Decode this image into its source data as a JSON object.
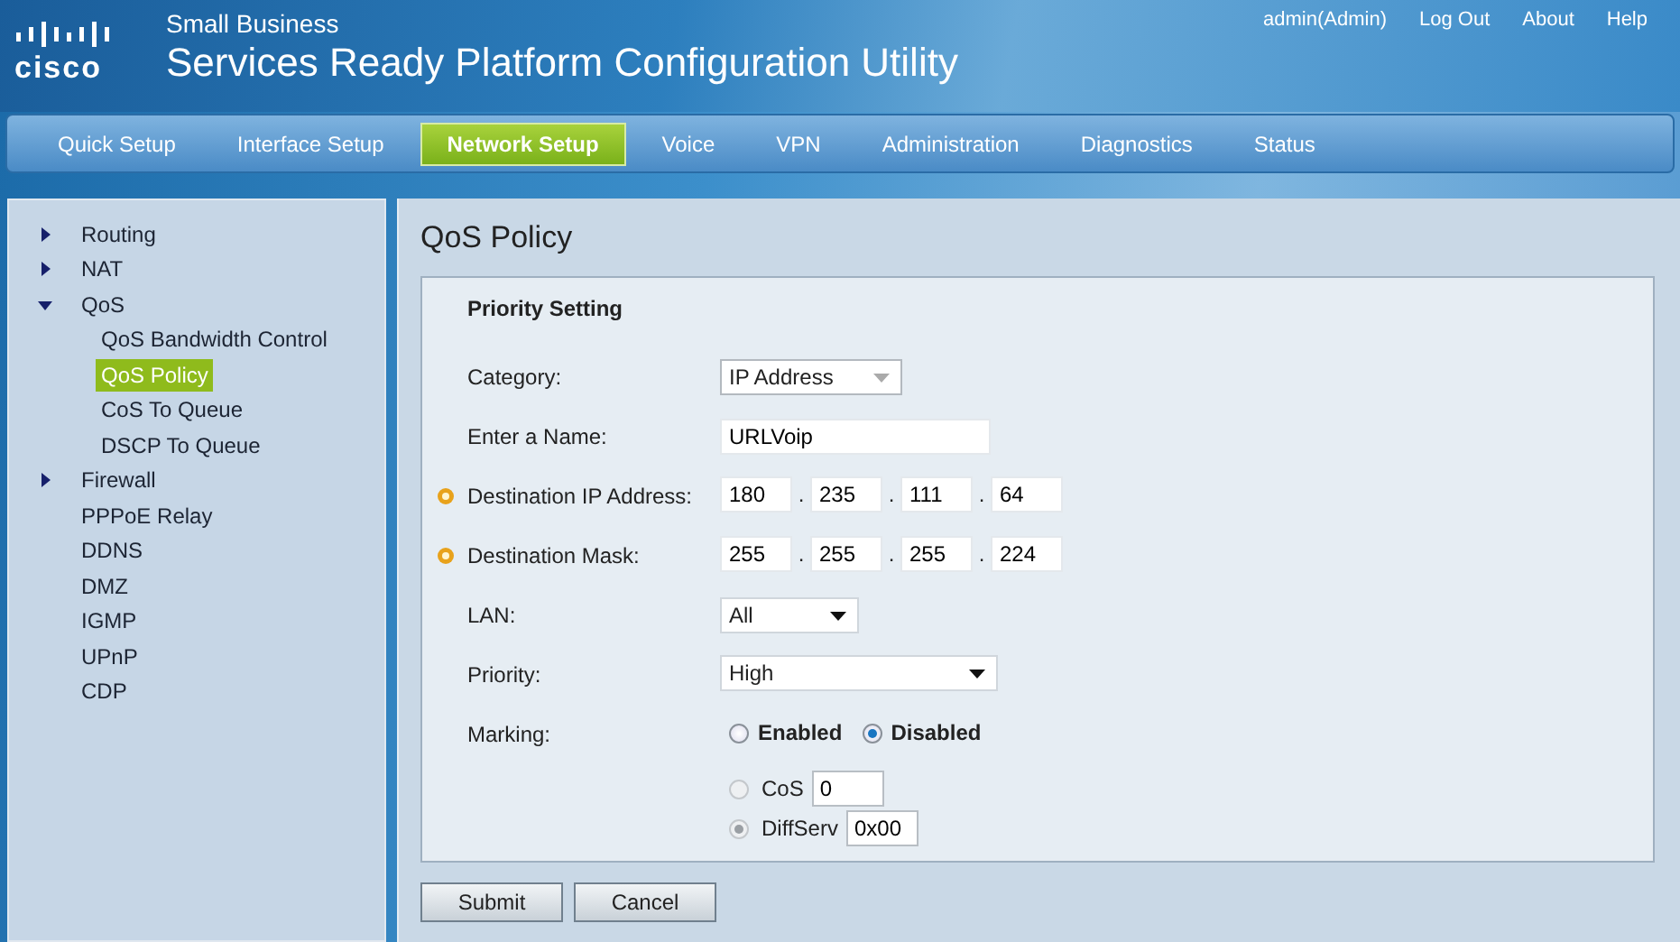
{
  "header": {
    "brand": "cisco",
    "subtitle": "Small Business",
    "title": "Services Ready Platform Configuration Utility",
    "links": [
      "admin(Admin)",
      "Log Out",
      "About",
      "Help"
    ]
  },
  "nav": [
    {
      "label": "Quick Setup",
      "selected": false
    },
    {
      "label": "Interface Setup",
      "selected": false
    },
    {
      "label": "Network Setup",
      "selected": true
    },
    {
      "label": "Voice",
      "selected": false
    },
    {
      "label": "VPN",
      "selected": false
    },
    {
      "label": "Administration",
      "selected": false
    },
    {
      "label": "Diagnostics",
      "selected": false
    },
    {
      "label": "Status",
      "selected": false
    }
  ],
  "sidebar": {
    "items": [
      {
        "kind": "group",
        "label": "Routing",
        "expanded": false
      },
      {
        "kind": "group",
        "label": "NAT",
        "expanded": false
      },
      {
        "kind": "group",
        "label": "QoS",
        "expanded": true,
        "children": [
          {
            "label": "QoS Bandwidth Control",
            "selected": false
          },
          {
            "label": "QoS Policy",
            "selected": true
          },
          {
            "label": "CoS To Queue",
            "selected": false
          },
          {
            "label": "DSCP To Queue",
            "selected": false
          }
        ]
      },
      {
        "kind": "group",
        "label": "Firewall",
        "expanded": false
      },
      {
        "kind": "link",
        "label": "PPPoE Relay"
      },
      {
        "kind": "link",
        "label": "DDNS"
      },
      {
        "kind": "link",
        "label": "DMZ"
      },
      {
        "kind": "link",
        "label": "IGMP"
      },
      {
        "kind": "link",
        "label": "UPnP"
      },
      {
        "kind": "link",
        "label": "CDP"
      }
    ]
  },
  "page": {
    "title": "QoS Policy",
    "section": "Priority Setting",
    "fields": [
      {
        "kind": "select",
        "label": "Category:",
        "value": "IP Address",
        "required": false,
        "disabled": true
      },
      {
        "kind": "text",
        "label": "Enter a Name:",
        "value": "URLVoip",
        "required": false
      },
      {
        "kind": "ip",
        "label": "Destination IP Address:",
        "octets": [
          "180",
          "235",
          "111",
          "64"
        ],
        "separators": [
          ".",
          ".",
          "."
        ],
        "required": true
      },
      {
        "kind": "ip",
        "label": "Destination Mask:",
        "octets": [
          "255",
          "255",
          "255",
          "224"
        ],
        "separators": [
          ".",
          ".",
          "."
        ],
        "required": true
      },
      {
        "kind": "select",
        "label": "LAN:",
        "value": "All",
        "required": false,
        "disabled": false
      },
      {
        "kind": "select",
        "label": "Priority:",
        "value": "High",
        "required": false,
        "disabled": false
      },
      {
        "kind": "radio",
        "label": "Marking:",
        "required": false,
        "options": [
          {
            "label": "Enabled",
            "selected": false
          },
          {
            "label": "Disabled",
            "selected": true
          }
        ],
        "sub_options": [
          {
            "label": "CoS",
            "value": "0",
            "selected": false,
            "disabled": true
          },
          {
            "label": "DiffServ",
            "value": "0x00",
            "selected": true,
            "disabled": true
          }
        ]
      }
    ]
  },
  "buttons": [
    "Submit",
    "Cancel"
  ]
}
